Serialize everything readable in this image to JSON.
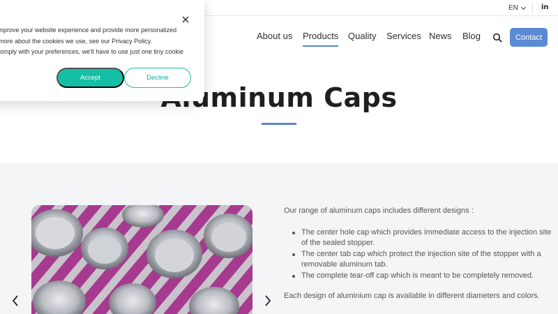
{
  "topbar": {
    "language": "EN",
    "linkedin_label": "in"
  },
  "nav": {
    "items": [
      {
        "label": "About us"
      },
      {
        "label": "Products",
        "active": true
      },
      {
        "label": "Quality"
      },
      {
        "label": "Services"
      },
      {
        "label": "News"
      },
      {
        "label": "Blog"
      }
    ],
    "contact_label": "Contact"
  },
  "hero": {
    "title": "Aluminum Caps"
  },
  "content": {
    "intro": "Our range of aluminum caps includes different designs :",
    "bullets": [
      "The center hole cap which provides immediate access to the injection site of the sealed stopper.",
      "The center tab cap which protect the injection site of the stopper with a removable aluminum tab.",
      "The complete tear-off cap which is meant to be completely removed."
    ],
    "footer_text": "Each design of aluminium cap is available in different diameters and colors."
  },
  "cookie": {
    "lines": [
      "o improve your website experience and provide more personalized",
      "ut more about the cookies we use, see our Privacy Policy.",
      "o comply with your preferences, we'll have to use just one tiny cookie"
    ],
    "accept_label": "Accept",
    "decline_label": "Decline"
  },
  "colors": {
    "accent": "#5b8ad6",
    "cookie_green": "#15bfa6",
    "section_bg": "#f3f5f7",
    "cap_magenta": "#a63a8f"
  },
  "icons": {
    "search": "search-icon",
    "close": "close-icon",
    "prev": "chevron-left-icon",
    "next": "chevron-right-icon"
  }
}
